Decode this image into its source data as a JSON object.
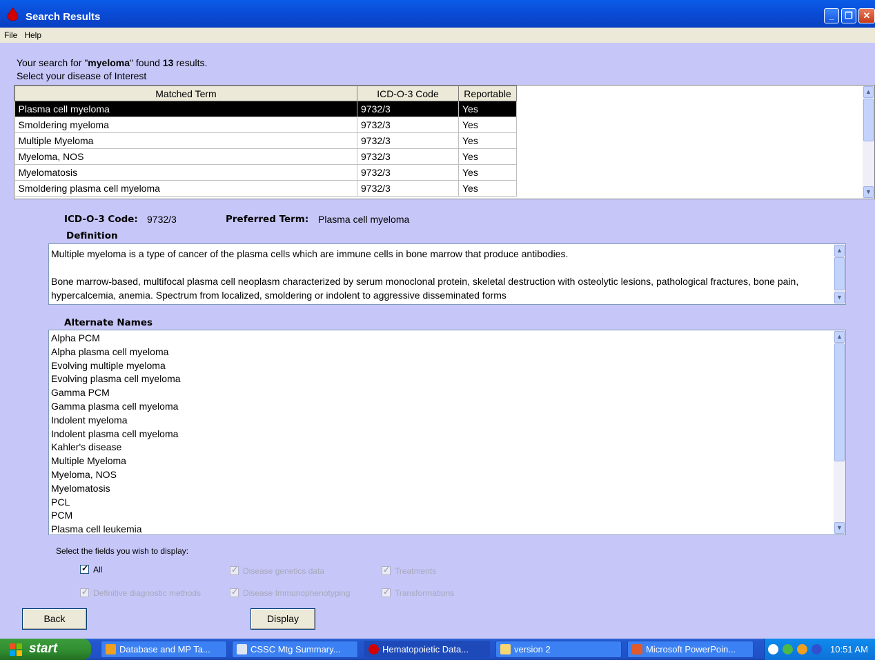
{
  "window": {
    "title": "Search Results",
    "menu": [
      "File",
      "Help"
    ]
  },
  "search": {
    "prefix": "Your search for \"",
    "term": "myeloma",
    "middle": "\" found",
    "count": "13",
    "suffix": "results.",
    "instruction": "Select your disease of Interest"
  },
  "results": {
    "headers": [
      "Matched Term",
      "ICD-O-3 Code",
      "Reportable"
    ],
    "rows": [
      {
        "term": "Plasma cell myeloma",
        "code": "9732/3",
        "reportable": "Yes"
      },
      {
        "term": "Smoldering myeloma",
        "code": "9732/3",
        "reportable": "Yes"
      },
      {
        "term": "Multiple Myeloma",
        "code": "9732/3",
        "reportable": "Yes"
      },
      {
        "term": "Myeloma, NOS",
        "code": "9732/3",
        "reportable": "Yes"
      },
      {
        "term": "Myelomatosis",
        "code": "9732/3",
        "reportable": "Yes"
      },
      {
        "term": "Smoldering plasma cell myeloma",
        "code": "9732/3",
        "reportable": "Yes"
      }
    ]
  },
  "detail": {
    "code_label": "ICD-O-3 Code:",
    "code_value": "9732/3",
    "preferred_label": "Preferred Term:",
    "preferred_value": "Plasma cell myeloma",
    "definition_label": "Definition",
    "definition_p1": "Multiple myeloma is a type of cancer of the plasma cells which are immune cells in bone marrow that produce antibodies.",
    "definition_p2": "Bone marrow-based, multifocal plasma cell neoplasm characterized by serum monoclonal protein, skeletal destruction with osteolytic lesions, pathological fractures, bone pain, hypercalcemia, anemia.  Spectrum from localized, smoldering or indolent to aggressive disseminated forms",
    "alternate_label": "Alternate Names",
    "alternate_names": [
      "Alpha PCM",
      "Alpha plasma cell myeloma",
      "Evolving multiple myeloma",
      "Evolving plasma cell myeloma",
      "Gamma PCM",
      "Gamma plasma cell myeloma",
      "Indolent myeloma",
      "Indolent plasma cell myeloma",
      "Kahler's disease",
      "Multiple Myeloma",
      "Myeloma, NOS",
      "Myelomatosis",
      "PCL",
      "PCM",
      "Plasma cell leukemia"
    ]
  },
  "fields": {
    "label": "Select the fields you wish to display:",
    "all": "All",
    "genetics": "Disease genetics data",
    "treatments": "Treatments",
    "diagnostic": "Definitive diagnostic methods",
    "immuno": "Disease Immunophenotyping",
    "transformations": "Transformations"
  },
  "buttons": {
    "back": "Back",
    "display": "Display"
  },
  "taskbar": {
    "start": "start",
    "tasks": [
      "Database and MP Ta...",
      "CSSC Mtg Summary...",
      "Hematopoietic Data...",
      "version 2",
      "Microsoft PowerPoin..."
    ],
    "clock": "10:51 AM"
  },
  "colors": {
    "titlebar": "#0a4bd6",
    "background": "#c6c6f8",
    "selection": "#000000",
    "start": "#2f8b2f"
  }
}
